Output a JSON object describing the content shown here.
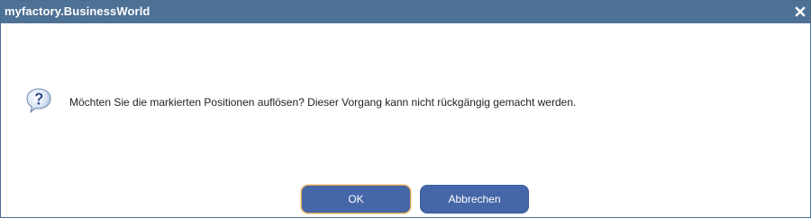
{
  "window": {
    "title": "myfactory.BusinessWorld"
  },
  "icons": {
    "close": "close-icon",
    "message": "question-icon"
  },
  "dialog": {
    "message": "Möchten Sie die markierten Positionen auflösen? Dieser Vorgang kann nicht rückgängig gemacht werden."
  },
  "buttons": {
    "ok_label": "OK",
    "cancel_label": "Abbrechen"
  },
  "colors": {
    "titlebar": "#4e7196",
    "button": "#4566a8",
    "focus_border": "#e0a44a"
  }
}
